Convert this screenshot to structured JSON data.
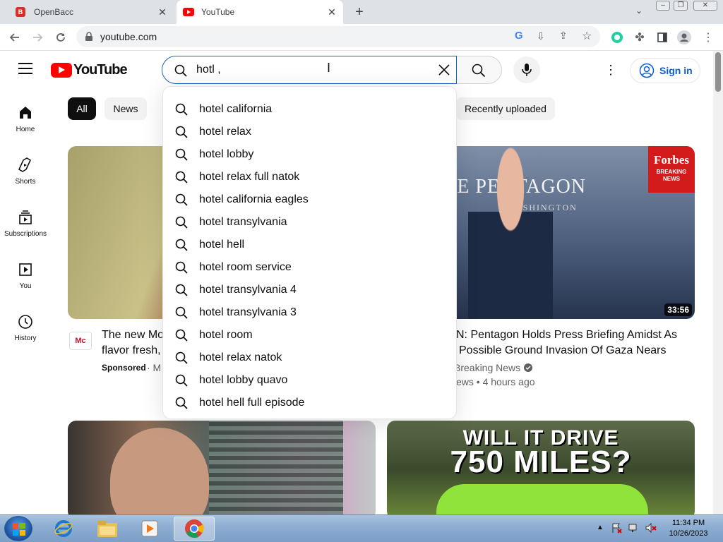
{
  "browser": {
    "tabs": [
      {
        "title": "OpenBacc",
        "favicon_letter": "B",
        "favicon_color": "#d93025"
      },
      {
        "title": "YouTube",
        "favicon_color": "#ff0000"
      }
    ],
    "url": "youtube.com"
  },
  "yt": {
    "logo_text": "YouTube",
    "search_value": "hotl ,",
    "signin_label": "Sign in",
    "nav": [
      {
        "label": "Home",
        "icon": "home-icon"
      },
      {
        "label": "Shorts",
        "icon": "shorts-icon"
      },
      {
        "label": "Subscriptions",
        "icon": "subscriptions-icon"
      },
      {
        "label": "You",
        "icon": "library-icon"
      },
      {
        "label": "History",
        "icon": "history-icon"
      }
    ],
    "chips": [
      "All",
      "News",
      "Recently uploaded"
    ],
    "suggestions": [
      "hotel california",
      "hotel relax",
      "hotel lobby",
      "hotel relax full natok",
      "hotel california eagles",
      "hotel transylvania",
      "hotel hell",
      "hotel room service",
      "hotel transylvania 4",
      "hotel transylvania 3",
      "hotel room",
      "hotel relax natok",
      "hotel lobby quavo",
      "hotel hell full episode"
    ],
    "videos": [
      {
        "title_line1": "The new Mo",
        "title_line2": "flavor fresh,",
        "sponsored": "Sponsored",
        "meta_tail": "· M"
      },
      {
        "title_line1": "N: Pentagon Holds Press Briefing Amidst As",
        "title_line2": "Possible Ground Invasion Of Gaza Nears",
        "channel": "Breaking News",
        "meta": "ews • 4 hours ago",
        "duration": "33:56",
        "badge_title": "Forbes",
        "badge_sub": "BREAKING NEWS",
        "backdrop_text": "THE PENTAGON",
        "backdrop_sub": "WASHINGTON"
      },
      {
        "title_line1": "",
        "title_line2": ""
      },
      {
        "overlay_line1": "WILL IT DRIVE",
        "overlay_line2": "750 MILES?"
      }
    ]
  },
  "taskbar": {
    "time": "11:34 PM",
    "date": "10/26/2023"
  }
}
